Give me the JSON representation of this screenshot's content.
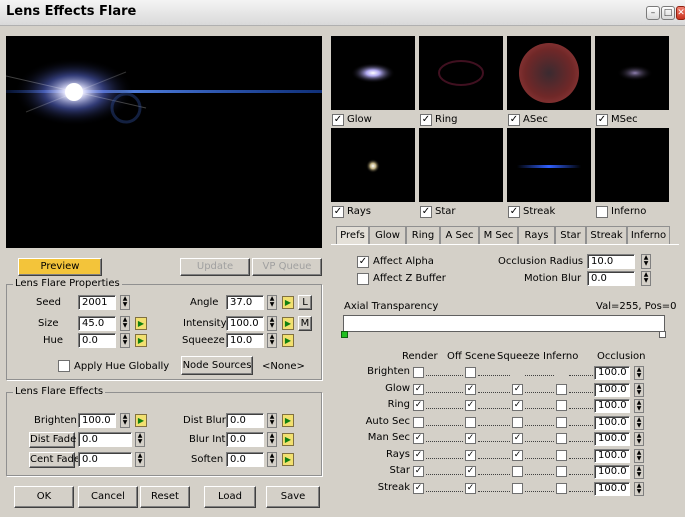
{
  "window": {
    "title": "Lens Effects Flare"
  },
  "thumbs": [
    {
      "label": "Glow",
      "checked": true
    },
    {
      "label": "Ring",
      "checked": true
    },
    {
      "label": "ASec",
      "checked": true
    },
    {
      "label": "MSec",
      "checked": true
    },
    {
      "label": "Rays",
      "checked": true
    },
    {
      "label": "Star",
      "checked": true
    },
    {
      "label": "Streak",
      "checked": true
    },
    {
      "label": "Inferno",
      "checked": false
    }
  ],
  "tabs": [
    "Prefs",
    "Glow",
    "Ring",
    "A Sec",
    "M Sec",
    "Rays",
    "Star",
    "Streak",
    "Inferno"
  ],
  "buttons": {
    "preview": "Preview",
    "update": "Update",
    "vp_queue": "VP Queue",
    "node_sources": "Node Sources",
    "node_value": "<None>",
    "ok": "OK",
    "cancel": "Cancel",
    "reset": "Reset",
    "load": "Load",
    "save": "Save"
  },
  "properties": {
    "title": "Lens Flare Properties",
    "seed_label": "Seed",
    "seed": "2001",
    "size_label": "Size",
    "size": "45.0",
    "hue_label": "Hue",
    "hue": "0.0",
    "angle_label": "Angle",
    "angle": "37.0",
    "intensity_label": "Intensity",
    "intensity": "100.0",
    "squeeze_label": "Squeeze",
    "squeeze": "10.0",
    "lock_l": "L",
    "lock_m": "M",
    "apply_hue": "Apply Hue Globally"
  },
  "effects": {
    "title": "Lens Flare Effects",
    "brighten_label": "Brighten",
    "brighten": "100.0",
    "dist_fade_label": "Dist Fade",
    "dist_fade": "0.0",
    "cent_fade_label": "Cent Fade",
    "cent_fade": "0.0",
    "dist_blur_label": "Dist Blur",
    "dist_blur": "0.0",
    "blur_int_label": "Blur Int",
    "blur_int": "0.0",
    "soften_label": "Soften",
    "soften": "0.0"
  },
  "prefs": {
    "affect_alpha": "Affect Alpha",
    "affect_alpha_checked": true,
    "affect_z": "Affect Z Buffer",
    "affect_z_checked": false,
    "occlusion_radius_label": "Occlusion Radius",
    "occlusion_radius": "10.0",
    "motion_blur_label": "Motion Blur",
    "motion_blur": "0.0",
    "axial_label": "Axial Transparency",
    "axial_value": "Val=255, Pos=0"
  },
  "table": {
    "headers": [
      "Render",
      "Off Scene",
      "Squeeze",
      "Inferno",
      "Occlusion"
    ],
    "rows": [
      {
        "label": "Brighten",
        "render": false,
        "off": false,
        "squeeze": null,
        "inferno": null,
        "occ": "100.0"
      },
      {
        "label": "Glow",
        "render": true,
        "off": true,
        "squeeze": true,
        "inferno": false,
        "occ": "100.0"
      },
      {
        "label": "Ring",
        "render": true,
        "off": true,
        "squeeze": true,
        "inferno": false,
        "occ": "100.0"
      },
      {
        "label": "Auto Sec",
        "render": false,
        "off": false,
        "squeeze": false,
        "inferno": false,
        "occ": "100.0"
      },
      {
        "label": "Man Sec",
        "render": true,
        "off": true,
        "squeeze": true,
        "inferno": false,
        "occ": "100.0"
      },
      {
        "label": "Rays",
        "render": true,
        "off": true,
        "squeeze": true,
        "inferno": false,
        "occ": "100.0"
      },
      {
        "label": "Star",
        "render": true,
        "off": true,
        "squeeze": false,
        "inferno": false,
        "occ": "100.0"
      },
      {
        "label": "Streak",
        "render": true,
        "off": true,
        "squeeze": false,
        "inferno": false,
        "occ": "100.0"
      }
    ]
  },
  "colors": {
    "preview_button": "#f3c43a",
    "highlight": "#ffffff"
  }
}
